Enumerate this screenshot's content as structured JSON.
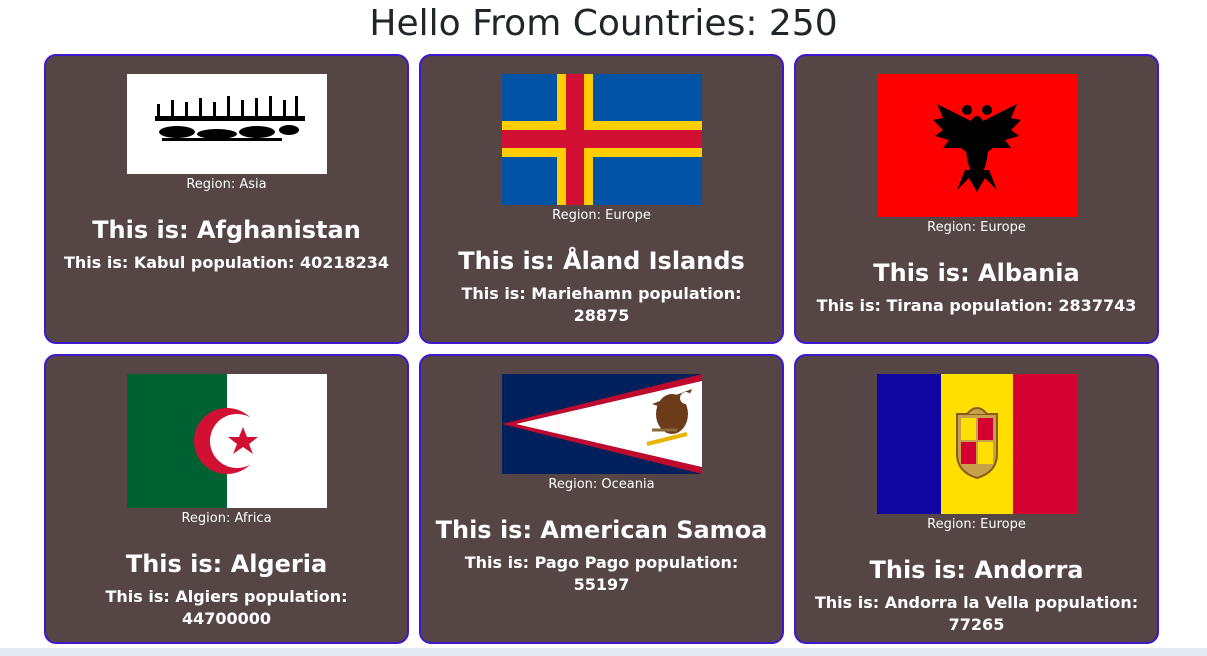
{
  "heading": "Hello From Countries: 250",
  "countries": [
    {
      "region_label": "Region: Asia",
      "name_label": "This is: Afghanistan",
      "capital_label": "This is: Kabul population: 40218234",
      "flag_icon": "afghanistan-flag-icon"
    },
    {
      "region_label": "Region: Europe",
      "name_label": "This is: Åland Islands",
      "capital_label": "This is: Mariehamn population: 28875",
      "flag_icon": "aland-islands-flag-icon"
    },
    {
      "region_label": "Region: Europe",
      "name_label": "This is: Albania",
      "capital_label": "This is: Tirana population: 2837743",
      "flag_icon": "albania-flag-icon"
    },
    {
      "region_label": "Region: Africa",
      "name_label": "This is: Algeria",
      "capital_label": "This is: Algiers population: 44700000",
      "flag_icon": "algeria-flag-icon"
    },
    {
      "region_label": "Region: Oceania",
      "name_label": "This is: American Samoa",
      "capital_label": "This is: Pago Pago population: 55197",
      "flag_icon": "american-samoa-flag-icon"
    },
    {
      "region_label": "Region: Europe",
      "name_label": "This is: Andorra",
      "capital_label": "This is: Andorra la Vella population: 77265",
      "flag_icon": "andorra-flag-icon"
    }
  ],
  "colors": {
    "card_background": "#554545",
    "card_border": "#3f17cf",
    "text": "#ffffff"
  }
}
